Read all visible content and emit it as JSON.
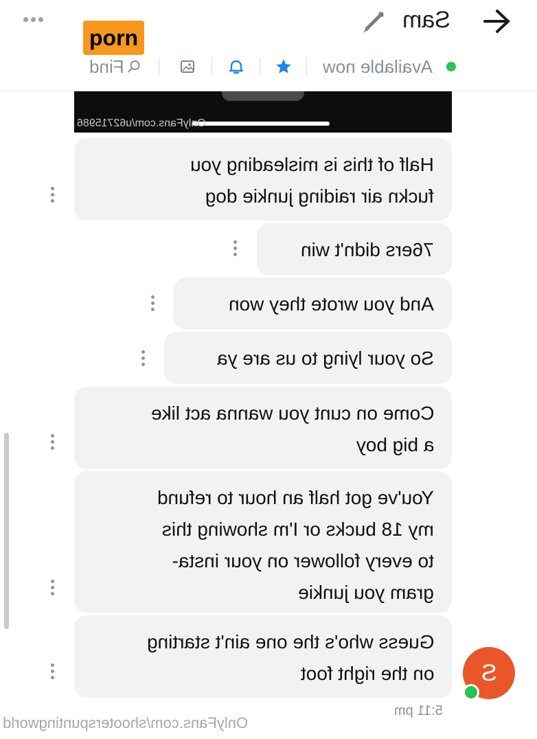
{
  "header": {
    "name": "Sam",
    "badge": "porn",
    "availability": "Available now",
    "find_label": "Find",
    "icons": [
      "back-arrow-icon",
      "pencil-icon",
      "more-dots-icon",
      "star-icon",
      "bell-icon",
      "image-icon",
      "search-icon"
    ]
  },
  "media": {
    "watermark": "OnlyFans.com/u62715986"
  },
  "messages": [
    {
      "text": "Half of this is misleading you\nfuckn air raiding junkie dog"
    },
    {
      "text": "76ers didn't win"
    },
    {
      "text": "And you wrote they won"
    },
    {
      "text": "So your lying to us are ya"
    },
    {
      "text": "Come on cunt you wanna act like\na big boy"
    },
    {
      "text": "You've got half an hour to refund\nmy 18 bucks or I'm showing this\nto every follower on your insta-\ngram you junkie"
    },
    {
      "text": "Guess who's the one ain't starting\non the right foot"
    }
  ],
  "footer": {
    "time": "5:11 pm",
    "avatar_initial": "S",
    "watermark": "OnlyFans.com/shooterspuntingworld"
  },
  "colors": {
    "accent_blue": "#1e88e5",
    "online_green": "#2bc257",
    "avatar_orange": "#e8562a",
    "badge_orange": "#f7971d"
  }
}
